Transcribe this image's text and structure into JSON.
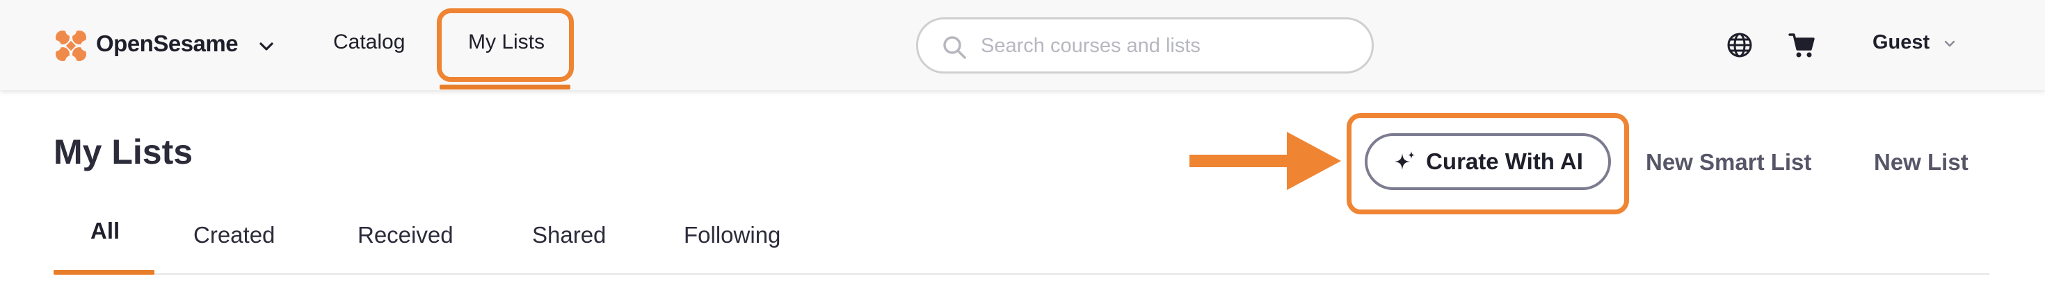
{
  "header": {
    "brand": "OpenSesame",
    "nav": [
      {
        "label": "Catalog"
      },
      {
        "label": "My Lists",
        "active": true
      }
    ],
    "search": {
      "placeholder": "Search courses and lists",
      "value": ""
    },
    "icons": [
      "globe-icon",
      "cart-icon"
    ],
    "user": {
      "name": "Guest"
    }
  },
  "page": {
    "title": "My Lists",
    "actions": {
      "curate": "Curate With AI",
      "new_smart_list": "New Smart List",
      "new_list": "New List"
    },
    "tabs": [
      {
        "label": "All",
        "active": true
      },
      {
        "label": "Created"
      },
      {
        "label": "Received"
      },
      {
        "label": "Shared"
      },
      {
        "label": "Following"
      }
    ]
  },
  "colors": {
    "accent": "#E87D2A",
    "highlight": "#EF8433",
    "text": "#1F1F2B",
    "muted": "#565668",
    "search_placeholder": "#B7B7C0",
    "topbar_bg": "#F8F8F8"
  }
}
